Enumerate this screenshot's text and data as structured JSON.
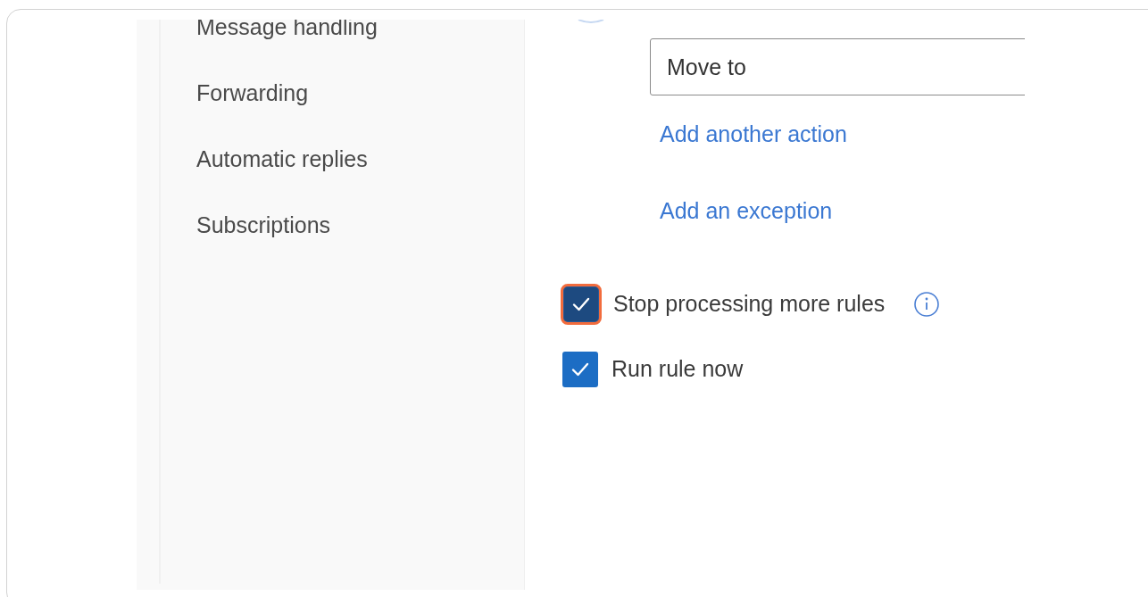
{
  "sidebar": {
    "items": [
      {
        "label": "Message handling",
        "selected": false
      },
      {
        "label": "Forwarding",
        "selected": false
      },
      {
        "label": "Automatic replies",
        "selected": false
      },
      {
        "label": "Subscriptions",
        "selected": false
      }
    ]
  },
  "action": {
    "value": "Move to"
  },
  "links": [
    "Add another action",
    "Add an exception"
  ],
  "options": [
    {
      "label": "Stop processing more rules",
      "checked": true,
      "highlighted": true,
      "info": true
    },
    {
      "label": "Run rule now",
      "checked": true,
      "highlighted": false,
      "info": false
    }
  ]
}
